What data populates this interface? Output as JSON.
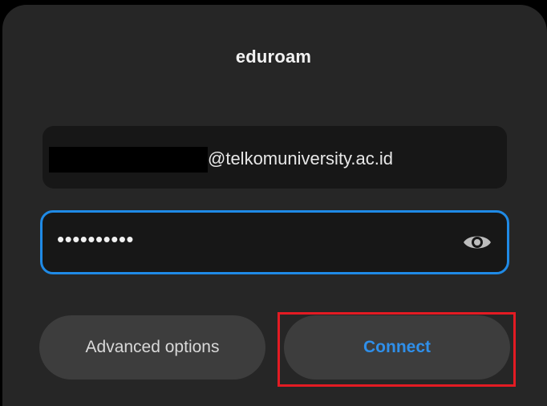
{
  "dialog": {
    "title": "eduroam"
  },
  "username": {
    "suffix": "@telkomuniversity.ac.id",
    "redacted": true
  },
  "password": {
    "value": "••••••••••",
    "visibility_icon": "eye-icon"
  },
  "buttons": {
    "advanced_label": "Advanced options",
    "connect_label": "Connect"
  },
  "colors": {
    "accent": "#1f8ae6",
    "connect_text": "#2f8fea",
    "highlight": "#e31b23",
    "dialog_bg": "#262626",
    "field_bg": "#171717",
    "button_bg": "#3d3d3d"
  }
}
